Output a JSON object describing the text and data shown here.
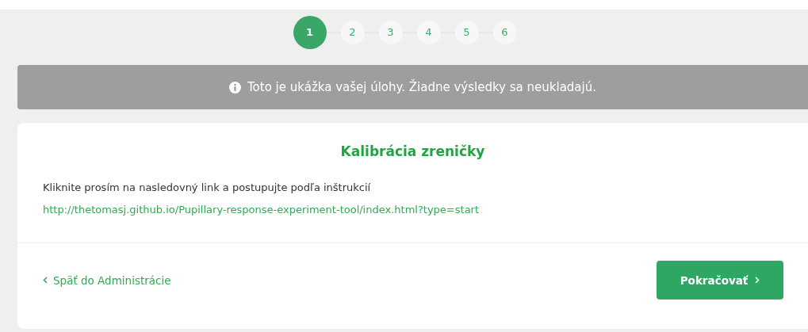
{
  "steps": [
    {
      "label": "1",
      "selected": true
    },
    {
      "label": "2",
      "selected": false
    },
    {
      "label": "3",
      "selected": false
    },
    {
      "label": "4",
      "selected": false
    },
    {
      "label": "5",
      "selected": false
    },
    {
      "label": "6",
      "selected": false
    }
  ],
  "notice": {
    "text": "Toto je ukážka vašej úlohy. Žiadne výsledky sa neukladajú."
  },
  "card": {
    "title": "Kalibrácia zreničky",
    "instruction": "Kliknite prosím na nasledovný link a postupujte podľa inštrukcií",
    "link": "http://thetomasj.github.io/Pupillary-response-experiment-tool/index.html?type=start"
  },
  "footer": {
    "back_link": "Späť do Administrácie",
    "continue_button": "Pokračovať"
  }
}
